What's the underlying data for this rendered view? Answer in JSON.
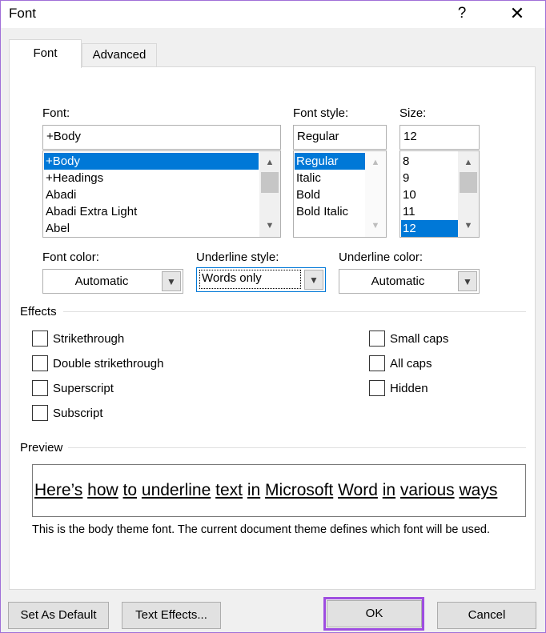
{
  "window": {
    "title": "Font",
    "help_label": "?",
    "close_label": "✕"
  },
  "tabs": [
    {
      "label": "Font",
      "selected": true
    },
    {
      "label": "Advanced",
      "selected": false
    }
  ],
  "font": {
    "label": "Font:",
    "value": "+Body",
    "items": [
      "+Body",
      "+Headings",
      "Abadi",
      "Abadi Extra Light",
      "Abel"
    ],
    "selected_index": 0
  },
  "font_style": {
    "label": "Font style:",
    "value": "Regular",
    "items": [
      "Regular",
      "Italic",
      "Bold",
      "Bold Italic"
    ],
    "selected_index": 0
  },
  "size": {
    "label": "Size:",
    "value": "12",
    "items": [
      "8",
      "9",
      "10",
      "11",
      "12"
    ],
    "selected_index": 4
  },
  "font_color": {
    "label": "Font color:",
    "value": "Automatic"
  },
  "underline_style": {
    "label": "Underline style:",
    "value": "Words only"
  },
  "underline_color": {
    "label": "Underline color:",
    "value": "Automatic"
  },
  "effects": {
    "label": "Effects",
    "left": [
      {
        "label": "Strikethrough",
        "checked": false
      },
      {
        "label": "Double strikethrough",
        "checked": false
      },
      {
        "label": "Superscript",
        "checked": false
      },
      {
        "label": "Subscript",
        "checked": false
      }
    ],
    "right": [
      {
        "label": "Small caps",
        "checked": false
      },
      {
        "label": "All caps",
        "checked": false
      },
      {
        "label": "Hidden",
        "checked": false
      }
    ]
  },
  "preview": {
    "label": "Preview",
    "text": "Here’s how to underline text in Microsoft Word in various ways",
    "note": "This is the body theme font. The current document theme defines which font will be used."
  },
  "buttons": {
    "set_default": "Set As Default",
    "text_effects": "Text Effects...",
    "ok": "OK",
    "cancel": "Cancel"
  },
  "colors": {
    "selection": "#0078d7",
    "highlight_border": "#9e4de0"
  },
  "icons": {
    "scroll_up": "▲",
    "scroll_down": "▼",
    "dropdown": "▼"
  }
}
